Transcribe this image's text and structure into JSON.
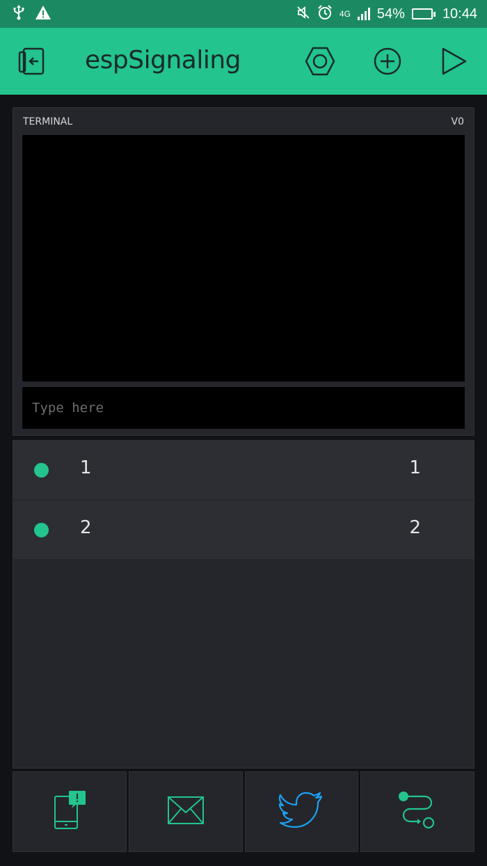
{
  "status_bar": {
    "battery_percent": "54%",
    "network": "4G",
    "time": "10:44",
    "battery_level": 0.54,
    "icons": [
      "usb-icon",
      "warning-icon",
      "mute-icon",
      "alarm-icon",
      "signal-icon",
      "battery-icon"
    ]
  },
  "app_bar": {
    "title": "espSignaling",
    "icons": [
      "exit-icon",
      "hexagon-settings-icon",
      "add-circle-icon",
      "play-icon"
    ]
  },
  "terminal": {
    "label": "TERMINAL",
    "pin": "V0",
    "input_placeholder": "Type here",
    "input_value": ""
  },
  "table": {
    "rows": [
      {
        "name": "1",
        "value": "1"
      },
      {
        "name": "2",
        "value": "2"
      }
    ]
  },
  "bottom_widgets": [
    {
      "icon": "notification-icon"
    },
    {
      "icon": "email-icon"
    },
    {
      "icon": "twitter-icon"
    },
    {
      "icon": "eventor-icon"
    }
  ],
  "colors": {
    "accent": "#23c48e",
    "statusbar": "#1b8a62",
    "background": "#111216",
    "widget": "#24262b",
    "twitter": "#1da1f2"
  }
}
